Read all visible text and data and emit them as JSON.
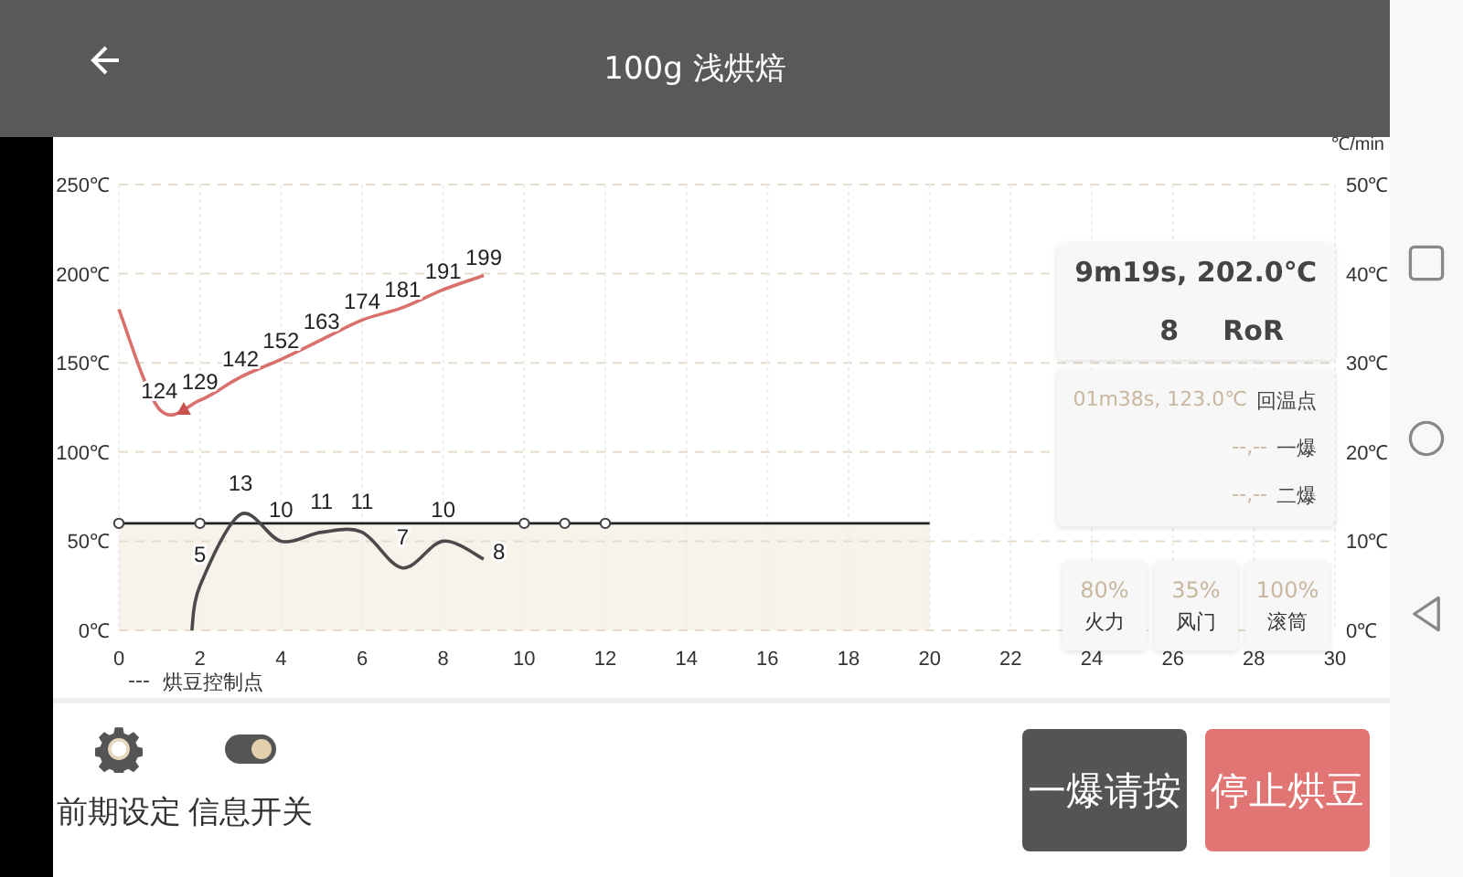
{
  "header": {
    "title": "100g 浅烘焙"
  },
  "chart": {
    "legend": {
      "symbol": "---",
      "label": "烘豆控制点"
    },
    "chart_data": {
      "type": "line",
      "x": [
        0,
        1,
        2,
        3,
        4,
        5,
        6,
        7,
        8,
        9
      ],
      "series": [
        {
          "color": "#d9706c",
          "values": [
            180,
            124,
            129,
            142,
            152,
            163,
            174,
            181,
            191,
            199
          ],
          "value_labels": [
            null,
            "124",
            "129",
            "142",
            "152",
            "163",
            "174",
            "181",
            "191",
            "199"
          ]
        }
      ],
      "xlim": [
        0,
        30
      ],
      "ylim": [
        0,
        250
      ],
      "grid": true,
      "xticks": [
        0,
        2,
        4,
        6,
        8,
        10,
        12,
        14,
        16,
        18,
        20,
        22,
        24,
        26,
        28,
        30
      ],
      "yticks": [
        {
          "value": 0,
          "label": "0℃"
        },
        {
          "value": 50,
          "label": "50℃"
        },
        {
          "value": 100,
          "label": "100℃"
        },
        {
          "value": 150,
          "label": "150℃"
        },
        {
          "value": 200,
          "label": "200℃"
        },
        {
          "value": 250,
          "label": "250℃"
        }
      ]
    }
  },
  "ror_chart": {
    "chart_data": {
      "type": "line",
      "ylabel": "℃/min",
      "x": [
        1.8,
        2,
        3,
        4,
        5,
        6,
        7,
        8,
        9
      ],
      "series": [
        {
          "color": "#4a4a4a",
          "values": [
            0,
            5,
            13,
            10,
            11,
            11,
            7,
            10,
            8
          ],
          "value_labels": [
            null,
            "5",
            "13",
            "10",
            "11",
            "11",
            "7",
            "10",
            "8"
          ]
        }
      ],
      "xlim": [
        0,
        30
      ],
      "ylim": [
        0,
        50
      ],
      "yticks": [
        {
          "value": 0,
          "label": "0℃"
        },
        {
          "value": 10,
          "label": "10℃"
        },
        {
          "value": 20,
          "label": "20℃"
        },
        {
          "value": 30,
          "label": "30℃"
        },
        {
          "value": 40,
          "label": "40℃"
        },
        {
          "value": 50,
          "label": "50℃"
        }
      ]
    }
  },
  "readout": {
    "time_temp": "9m19s, 202.0℃",
    "ror_value": "8",
    "ror_label": "RoR"
  },
  "events": [
    {
      "value": "01m38s, 123.0℃",
      "label": "回温点"
    },
    {
      "value": "--,--",
      "label": "一爆"
    },
    {
      "value": "--,--",
      "label": "二爆"
    }
  ],
  "settings": [
    {
      "value": "80%",
      "label": "火力"
    },
    {
      "value": "35%",
      "label": "风门"
    },
    {
      "value": "100%",
      "label": "滚筒"
    }
  ],
  "tools": [
    {
      "kind": "gear",
      "label": "前期设定"
    },
    {
      "kind": "toggle",
      "label": "信息开关",
      "on": true
    }
  ],
  "buttons": [
    {
      "kind": "dark",
      "label": "一爆请按"
    },
    {
      "kind": "red",
      "label": "停止烘豆"
    }
  ]
}
